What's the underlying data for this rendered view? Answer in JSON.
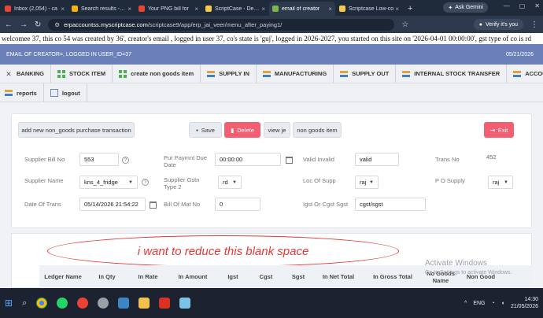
{
  "browser": {
    "tabs": [
      {
        "label": "Inbox (2,054) - ca",
        "color": "#ea4335",
        "active": false
      },
      {
        "label": "Search results - co",
        "color": "#f4b400",
        "active": false
      },
      {
        "label": "Your PNG bill for",
        "color": "#ea4335",
        "active": false
      },
      {
        "label": "ScriptCase - Devel",
        "color": "#f7c948",
        "active": false
      },
      {
        "label": "email of creator",
        "color": "#7ab648",
        "active": true
      },
      {
        "label": "Scriptcase Low-co",
        "color": "#f7c948",
        "active": false
      }
    ],
    "new_tab": "+",
    "gemini_label": "Ask Gemini",
    "url_host": "erpaccountss.myscriptcase.com",
    "url_path": "/scriptcase9/app/erp_jai_veer/menu_after_paying1/",
    "verify_label": "Verify it's you"
  },
  "welcome_text": "welcomee 37, this co 54 was created by 36', creator's email , logged in user 37, co's state is 'guj', logged in 2026-2027, you started on this site on '2026-04-01 00:00:00', gst type of co is rd",
  "header": {
    "title": "EMAIL OF CREATOR=, LOGGED IN USER_ID=37",
    "date": "05/21/2026"
  },
  "menu": {
    "row1": [
      {
        "label": "BANKING",
        "icon": "close-icon"
      },
      {
        "label": "STOCK ITEM",
        "icon": "grid-icon"
      },
      {
        "label": "create non goods item",
        "icon": "grid-icon"
      },
      {
        "label": "SUPPLY IN",
        "icon": "bars-icon"
      },
      {
        "label": "MANUFACTURING",
        "icon": "bars-icon"
      },
      {
        "label": "SUPPLY OUT",
        "icon": "bars-icon"
      },
      {
        "label": "INTERNAL STOCK TRANSFER",
        "icon": "bars-icon"
      },
      {
        "label": "ACCOUNTANT",
        "icon": "bars-icon"
      }
    ],
    "row2": [
      {
        "label": "reports",
        "icon": "bars-icon"
      },
      {
        "label": "logout",
        "icon": "doc-icon"
      }
    ]
  },
  "toolbar": {
    "add_label": "add new non_goods purchase transaction",
    "save_label": "Save",
    "delete_label": "Delete",
    "view_je_label": "view je",
    "non_goods_label": "non goods item",
    "exit_label": "Exit"
  },
  "form": {
    "supplier_bill_no": {
      "label": "Supplier Bill No",
      "value": "553"
    },
    "pur_paymnt_due_date": {
      "label": "Pur Paymnt Due Date",
      "value": "00:00:00"
    },
    "valid_invalid": {
      "label": "Valid Invalid",
      "value": "valid"
    },
    "trans_no": {
      "label": "Trans No",
      "value": "452"
    },
    "supplier_name": {
      "label": "Supplier Name",
      "value": "kns_4_fridge"
    },
    "supplier_gstn_type2": {
      "label": "Supplier Gstn Type 2",
      "value": "rd"
    },
    "loc_of_supp": {
      "label": "Loc Of Supp",
      "value": "raj"
    },
    "po_supply": {
      "label": "P O Supply",
      "value": "raj"
    },
    "date_of_trans": {
      "label": "Date Of Trans",
      "value": "05/14/2026 21:54:22"
    },
    "bill_of_mat_no": {
      "label": "Bill Of Mat No",
      "value": "0"
    },
    "igst_or_cgst_sgst": {
      "label": "Igst Or Cgst Sgst",
      "value": "cgst/sgst"
    }
  },
  "annotation_text": "i want to reduce this blank space",
  "grid": {
    "columns": [
      "Ledger Name",
      "In Qty",
      "In Rate",
      "In Amount",
      "Igst",
      "Cgst",
      "Sgst",
      "In Net Total",
      "In Gross Total",
      "No Goods Name",
      "Non Good"
    ]
  },
  "watermark": {
    "title": "Activate Windows",
    "sub": "Go to Settings to activate Windows."
  },
  "taskbar": {
    "lang": "ENG",
    "time": "14:30",
    "date": "21/05/2026"
  },
  "colors": {
    "header_bg": "#6b7fb8",
    "delete_red": "#f25f73",
    "annotation_red": "#e53935"
  }
}
